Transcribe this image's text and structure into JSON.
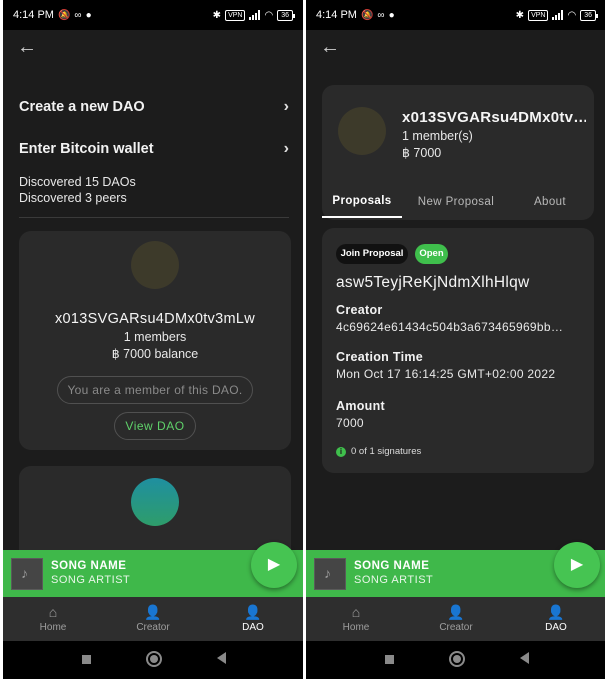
{
  "status": {
    "time": "4:14 PM",
    "vpn": "VPN",
    "battery": "36"
  },
  "left": {
    "menu": [
      {
        "label": "Create a new DAO"
      },
      {
        "label": "Enter Bitcoin wallet"
      }
    ],
    "discovered_daos": "Discovered 15 DAOs",
    "discovered_peers": "Discovered 3 peers",
    "dao_card": {
      "name": "x013SVGARsu4DMx0tv3mLw",
      "members": "1 members",
      "balance": "฿ 7000 balance",
      "member_notice": "You are a member of this DAO.",
      "view_button": "View DAO"
    }
  },
  "right": {
    "dao": {
      "name": "x013SVGARsu4DMx0tv…",
      "members": "1 member(s)",
      "balance": "฿ 7000"
    },
    "tabs": [
      "Proposals",
      "New Proposal",
      "About"
    ],
    "proposal": {
      "tag_join": "Join Proposal",
      "tag_open": "Open",
      "id": "asw5TeyjReKjNdmXlhHlqw",
      "creator_label": "Creator",
      "creator_value": "4c69624e61434c504b3a673465969bb…",
      "time_label": "Creation Time",
      "time_value": "Mon Oct 17 16:14:25 GMT+02:00 2022",
      "amount_label": "Amount",
      "amount_value": "7000",
      "signatures": "0 of 1 signatures"
    }
  },
  "player": {
    "song_name": "SONG NAME",
    "song_artist": "SONG ARTIST"
  },
  "nav": [
    {
      "label": "Home",
      "icon": "home-icon"
    },
    {
      "label": "Creator",
      "icon": "person-icon"
    },
    {
      "label": "DAO",
      "icon": "person-icon",
      "active": true
    }
  ],
  "colors": {
    "accent": "#3fb84a",
    "background": "#1c1c1c",
    "card": "#2a2a2a"
  }
}
